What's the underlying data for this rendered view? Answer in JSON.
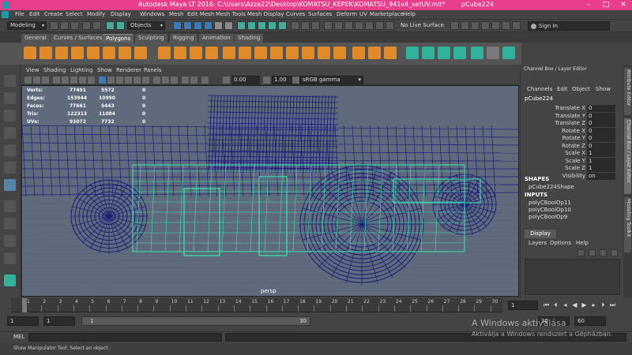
{
  "window": {
    "app_title": "Autodesk Maya LT 2016: C:\\Users\\Azza22\\Desktop\\KOMATSU_KEPEK\\KOMATSU_941v4_setUV.mlt*",
    "object_name": "pCube224",
    "min_glyph": "–",
    "max_glyph": "□",
    "close_glyph": "✕"
  },
  "menubar": [
    "File",
    "Edit",
    "Create",
    "Select",
    "Modify",
    "Display",
    "Windows",
    "Mesh",
    "Edit Mesh",
    "Mesh Tools",
    "Mesh Display",
    "Curves",
    "Surfaces",
    "Deform",
    "UV",
    "Marketplace",
    "Help"
  ],
  "statusline": {
    "mode": "Modeling",
    "objects_filter": "Objects",
    "live_surface": "No Live Surface",
    "sign_in": "Sign In"
  },
  "shelf_tabs": [
    "General",
    "Curves / Surfaces",
    "Polygons",
    "Sculpting",
    "Rigging",
    "Animation",
    "Shading"
  ],
  "active_shelf_tab": "Polygons",
  "viewport": {
    "menus": [
      "View",
      "Shading",
      "Lighting",
      "Show",
      "Renderer",
      "Panels"
    ],
    "exposure": "0.00",
    "gamma": "1.00",
    "color_space": "sRGB gamma",
    "camera": "persp",
    "hud": [
      {
        "label": "Verts:",
        "a": "77491",
        "b": "5572",
        "c": "0"
      },
      {
        "label": "Edges:",
        "a": "153944",
        "b": "10990",
        "c": "0"
      },
      {
        "label": "Faces:",
        "a": "77661",
        "b": "5443",
        "c": "0"
      },
      {
        "label": "Tris:",
        "a": "122313",
        "b": "11084",
        "c": "0"
      },
      {
        "label": "UVs:",
        "a": "93072",
        "b": "7732",
        "c": "0"
      }
    ]
  },
  "channel_box": {
    "header": "Channel Box / Layer Editor",
    "menus": [
      "Channels",
      "Edit",
      "Object",
      "Show"
    ],
    "object": "pCube224",
    "attributes": [
      {
        "label": "Translate X",
        "value": "0"
      },
      {
        "label": "Translate Y",
        "value": "0"
      },
      {
        "label": "Translate Z",
        "value": "0"
      },
      {
        "label": "Rotate X",
        "value": "0"
      },
      {
        "label": "Rotate Y",
        "value": "0"
      },
      {
        "label": "Rotate Z",
        "value": "0"
      },
      {
        "label": "Scale X",
        "value": "1"
      },
      {
        "label": "Scale Y",
        "value": "1"
      },
      {
        "label": "Scale Z",
        "value": "1"
      },
      {
        "label": "Visibility",
        "value": "on"
      }
    ],
    "shapes_title": "SHAPES",
    "shape": "pCube224Shape",
    "inputs_title": "INPUTS",
    "inputs": [
      "polyCBoolOp11",
      "polyCBoolOp10",
      "polyCBoolOp9"
    ],
    "display_tab": "Display",
    "layer_menus": [
      "Layers",
      "Options",
      "Help"
    ]
  },
  "side_tabs": [
    "Attribute Editor",
    "Channel Box / Layer Editor",
    "Modeling Toolkit"
  ],
  "timeline": {
    "ticks": [
      "1",
      "2",
      "3",
      "4",
      "5",
      "6",
      "7",
      "8",
      "9",
      "10",
      "11",
      "12",
      "13",
      "14",
      "15",
      "16",
      "17",
      "18",
      "19",
      "20",
      "21",
      "22",
      "23",
      "24",
      "25",
      "26",
      "27",
      "28",
      "29",
      "30"
    ],
    "current_frame": "1"
  },
  "range": {
    "start": "1",
    "start_inner": "1",
    "range_start_label": "1",
    "range_end_label": "30",
    "end_inner": "30",
    "end": "60"
  },
  "mel": {
    "label": "MEL"
  },
  "help_line": "Show Manipulator Tool: Select an object.",
  "watermark": {
    "line1": "A Windows aktiválása",
    "line2": "Aktiválja a Windows rendszert a Gépházban."
  },
  "colors": {
    "titlebar": "#e83e8c",
    "wire_dark": "#1a1d7a",
    "wire_selected": "#35e8b0",
    "viewport_bg": "#5f6b7c"
  }
}
